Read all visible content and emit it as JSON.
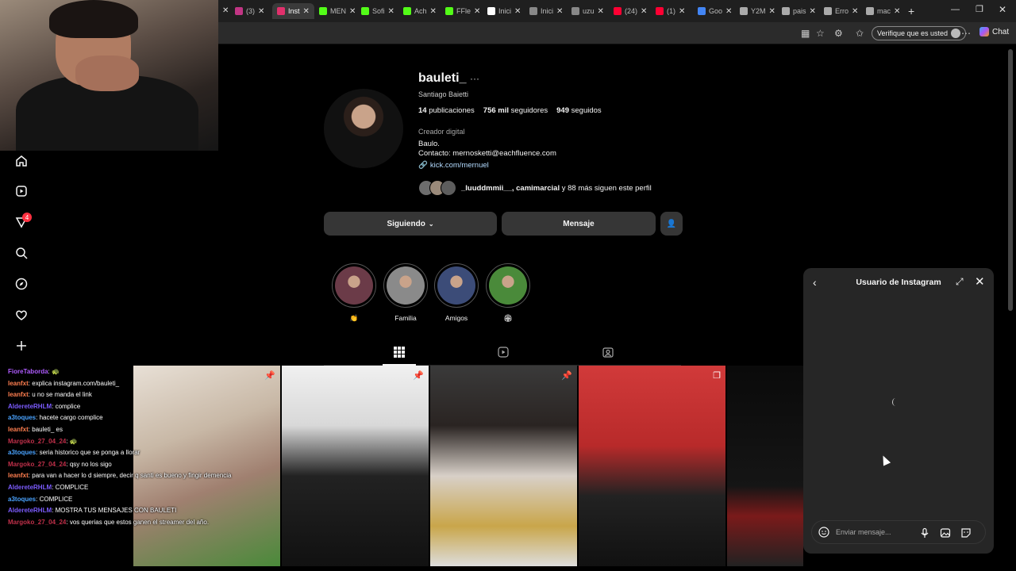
{
  "browser": {
    "tabs": [
      {
        "label": "(3)",
        "color": "#c13584"
      },
      {
        "label": "Inst",
        "color": "#e1306c",
        "active": true
      },
      {
        "label": "MEN",
        "color": "#53fc18"
      },
      {
        "label": "Sofi",
        "color": "#53fc18"
      },
      {
        "label": "Ach",
        "color": "#53fc18"
      },
      {
        "label": "FFle",
        "color": "#53fc18"
      },
      {
        "label": "Inici",
        "color": "#ffffff"
      },
      {
        "label": "Inici",
        "color": "#888888"
      },
      {
        "label": "uzu",
        "color": "#888888"
      },
      {
        "label": "(24)",
        "color": "#ff0033"
      },
      {
        "label": "(1)",
        "color": "#ff0033"
      },
      {
        "label": "Goo",
        "color": "#4285f4"
      },
      {
        "label": "Y2M",
        "color": "#aaaaaa"
      },
      {
        "label": "pais",
        "color": "#aaaaaa"
      },
      {
        "label": "Erro",
        "color": "#aaaaaa"
      },
      {
        "label": "mac",
        "color": "#aaaaaa"
      }
    ],
    "verify_label": "Verifique que es usted",
    "chat_label": "Chat"
  },
  "profile": {
    "username": "bauleti_",
    "full_name": "Santiago Baietti",
    "posts_count": "14",
    "posts_label": "publicaciones",
    "followers_count": "756 mil",
    "followers_label": "seguidores",
    "following_count": "949",
    "following_label": "seguidos",
    "category": "Creador digital",
    "bio_line1": "Baulo.",
    "bio_line2": "Contacto: mernosketti@eachfluence.com",
    "link": "kick.com/mernuel",
    "followed_by_names": "_luuddmmii__, camimarcial",
    "followed_by_rest": "y 88 más siguen este perfil",
    "following_button": "Siguiendo",
    "message_button": "Mensaje"
  },
  "highlights": [
    {
      "label": "👏",
      "color": "#6b3b48"
    },
    {
      "label": "Familia",
      "color": "#8a8a8a"
    },
    {
      "label": "Amigos",
      "color": "#3c4c78"
    },
    {
      "label": "🏟",
      "color": "#4a8a3a"
    }
  ],
  "notifications_badge": "4",
  "chat_messages": [
    {
      "user": "FioreTaborda",
      "color": "#b05cff",
      "text": ": 🐢"
    },
    {
      "user": "leanfxt",
      "color": "#ff7f50",
      "text": ": explica instagram.com/bauleti_"
    },
    {
      "user": "leanfxt",
      "color": "#ff7f50",
      "text": ": u no se manda el link"
    },
    {
      "user": "AldereteRHLM",
      "color": "#7c5cff",
      "text": ": complice"
    },
    {
      "user": "a3toques",
      "color": "#4aa3ff",
      "text": ": hacete cargo complice"
    },
    {
      "user": "leanfxt",
      "color": "#ff7f50",
      "text": ": bauleti_ es"
    },
    {
      "user": "Margoko_27_04_24",
      "color": "#c0304a",
      "text": ": 🐢"
    },
    {
      "user": "a3toques",
      "color": "#4aa3ff",
      "text": ": seria historico que se ponga a llorar"
    },
    {
      "user": "Margoko_27_04_24",
      "color": "#c0304a",
      "text": ": qsy no los sigo"
    },
    {
      "user": "leanfxt",
      "color": "#ff7f50",
      "text": ": para van a hacer lo d siempre, decir q santi es bueno y fingir demencia"
    },
    {
      "user": "AldereteRHLM",
      "color": "#7c5cff",
      "text": ": COMPLICE"
    },
    {
      "user": "a3toques",
      "color": "#4aa3ff",
      "text": ": COMPLICE"
    },
    {
      "user": "AldereteRHLM",
      "color": "#7c5cff",
      "text": ": MOSTRA TUS MENSAJES CON BAULETI"
    },
    {
      "user": "Margoko_27_04_24",
      "color": "#c0304a",
      "text": ": vos querias que estos ganen el streamer del año."
    }
  ],
  "dm": {
    "title": "Usuario de Instagram",
    "input_placeholder": "Enviar mensaje..."
  }
}
